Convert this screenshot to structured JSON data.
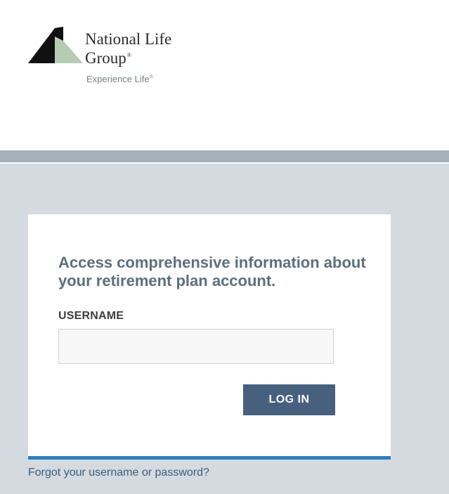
{
  "brand": {
    "name_line1": "National Life",
    "name_line2": "Group",
    "tagline": "Experience Life",
    "registered_mark": "®",
    "logo_colors": {
      "black": "#111111",
      "sage": "#b7cbb4"
    }
  },
  "login_card": {
    "headline": "Access comprehensive information about your retirement plan account.",
    "username_label": "USERNAME",
    "username_value": "",
    "login_button_label": "LOG IN"
  },
  "footer": {
    "forgot_link": "Forgot your username or password?"
  },
  "colors": {
    "band": "#a4b1ba",
    "background": "#d4dadf",
    "card_accent": "#2f7fbe",
    "button": "#46607e",
    "headline": "#5d6f7d",
    "link": "#3e5b7a"
  }
}
